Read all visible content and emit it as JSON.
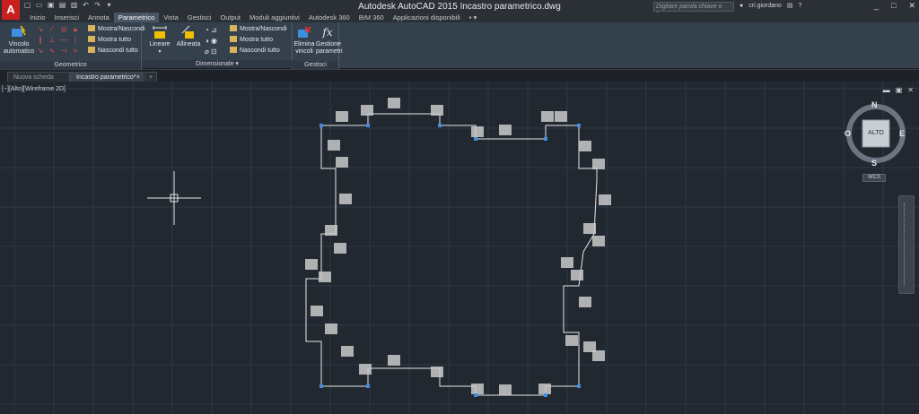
{
  "titlebar": {
    "app_logo": "A",
    "title": "Autodesk AutoCAD 2015    Incastro parametrico.dwg",
    "search_placeholder": "Digitare parola chiave o frase",
    "user": "cri.giordano",
    "qat_icons": [
      "new-icon",
      "open-icon",
      "save-icon",
      "saveas-icon",
      "print-icon",
      "undo-icon",
      "redo-icon",
      "dropdown-icon"
    ],
    "window_controls": [
      "_",
      "□",
      "✕"
    ]
  },
  "ribbon_tabs": [
    "Inizio",
    "Inserisci",
    "Annota",
    "Parametrico",
    "Vista",
    "Gestisci",
    "Output",
    "Moduli aggiuntivi",
    "Autodesk 360",
    "BIM 360",
    "Applicazioni disponibili"
  ],
  "active_tab": "Parametrico",
  "ribbon": {
    "geometrico": {
      "title": "Geometrico",
      "auto_constraint": "Vincolo\nautomatico",
      "show_hide": "Mostra/Nascondi",
      "show_all": "Mostra tutto",
      "hide_all": "Nascondi tutto"
    },
    "dimensionale": {
      "title": "Dimensionale",
      "linear": "Lineare",
      "aligned": "Allineata",
      "show_hide": "Mostra/Nascondi",
      "show_all": "Mostra tutto",
      "hide_all": "Nascondi tutto"
    },
    "gestisci": {
      "title": "Gestisci",
      "delete_constraints": "Elimina\nvincoli",
      "param_manager": "Gestione\nparametri"
    }
  },
  "file_tabs": [
    "Nuova scheda",
    "Incastro parametrico*"
  ],
  "viewport": {
    "label": "[−][Alto][Wireframe 2D]",
    "viewcube": {
      "top": "ALTO",
      "n": "N",
      "s": "S",
      "e": "E",
      "w": "O"
    },
    "wcs": "WCS"
  },
  "colors": {
    "background": "#212830",
    "grid_major": "#2f3946",
    "constraint_glyph": "#c9c9c9",
    "grip": "#3f8fe0",
    "accent_red": "#c8201f"
  }
}
